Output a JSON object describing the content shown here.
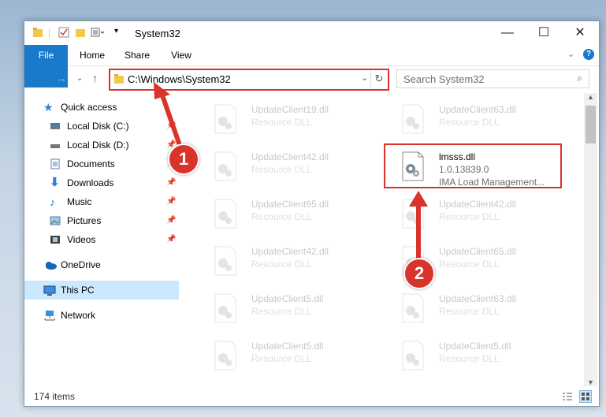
{
  "window": {
    "title": "System32",
    "controls": {
      "minimize": "—",
      "maximize": "☐",
      "close": "✕"
    }
  },
  "ribbon": {
    "tabs": [
      {
        "label": "File"
      },
      {
        "label": "Home"
      },
      {
        "label": "Share"
      },
      {
        "label": "View"
      }
    ],
    "help": "?"
  },
  "address": {
    "path": "C:\\Windows\\System32",
    "search_placeholder": "Search System32"
  },
  "sidebar": {
    "items": [
      {
        "label": "Quick access",
        "icon": "star-icon"
      },
      {
        "label": "Local Disk (C:)",
        "icon": "drive-icon",
        "pinned": true
      },
      {
        "label": "Local Disk (D:)",
        "icon": "drive-icon",
        "pinned": true
      },
      {
        "label": "Documents",
        "icon": "documents-icon",
        "pinned": true
      },
      {
        "label": "Downloads",
        "icon": "downloads-icon",
        "pinned": true
      },
      {
        "label": "Music",
        "icon": "music-icon",
        "pinned": true
      },
      {
        "label": "Pictures",
        "icon": "pictures-icon",
        "pinned": true
      },
      {
        "label": "Videos",
        "icon": "videos-icon",
        "pinned": true
      },
      {
        "label": "OneDrive",
        "icon": "cloud-icon"
      },
      {
        "label": "This PC",
        "icon": "computer-icon",
        "selected": true
      },
      {
        "label": "Network",
        "icon": "network-icon"
      }
    ]
  },
  "files": [
    {
      "name": "UpdateClient19.dll",
      "desc": "Resource DLL"
    },
    {
      "name": "UpdateClient63.dll",
      "desc": "Resource DLL"
    },
    {
      "name": "UpdateClient42.dll",
      "desc": "Resource DLL"
    },
    {
      "name": "lmsss.dll",
      "desc": "1.0.13839.0",
      "desc2": "IMA Load Management..."
    },
    {
      "name": "UpdateClient65.dll",
      "desc": "Resource DLL"
    },
    {
      "name": "UpdateClient42.dll",
      "desc": "Resource DLL"
    },
    {
      "name": "UpdateClient42.dll",
      "desc": "Resource DLL"
    },
    {
      "name": "UpdateClient65.dll",
      "desc": "Resource DLL"
    },
    {
      "name": "UpdateClient5.dll",
      "desc": "Resource DLL"
    },
    {
      "name": "UpdateClient63.dll",
      "desc": "Resource DLL"
    },
    {
      "name": "UpdateClient5.dll",
      "desc": "Resource DLL"
    },
    {
      "name": "UpdateClient5.dll",
      "desc": "Resource DLL"
    }
  ],
  "status": {
    "items": "174 items"
  },
  "annotations": {
    "one": "1",
    "two": "2",
    "color": "#d9342b"
  }
}
